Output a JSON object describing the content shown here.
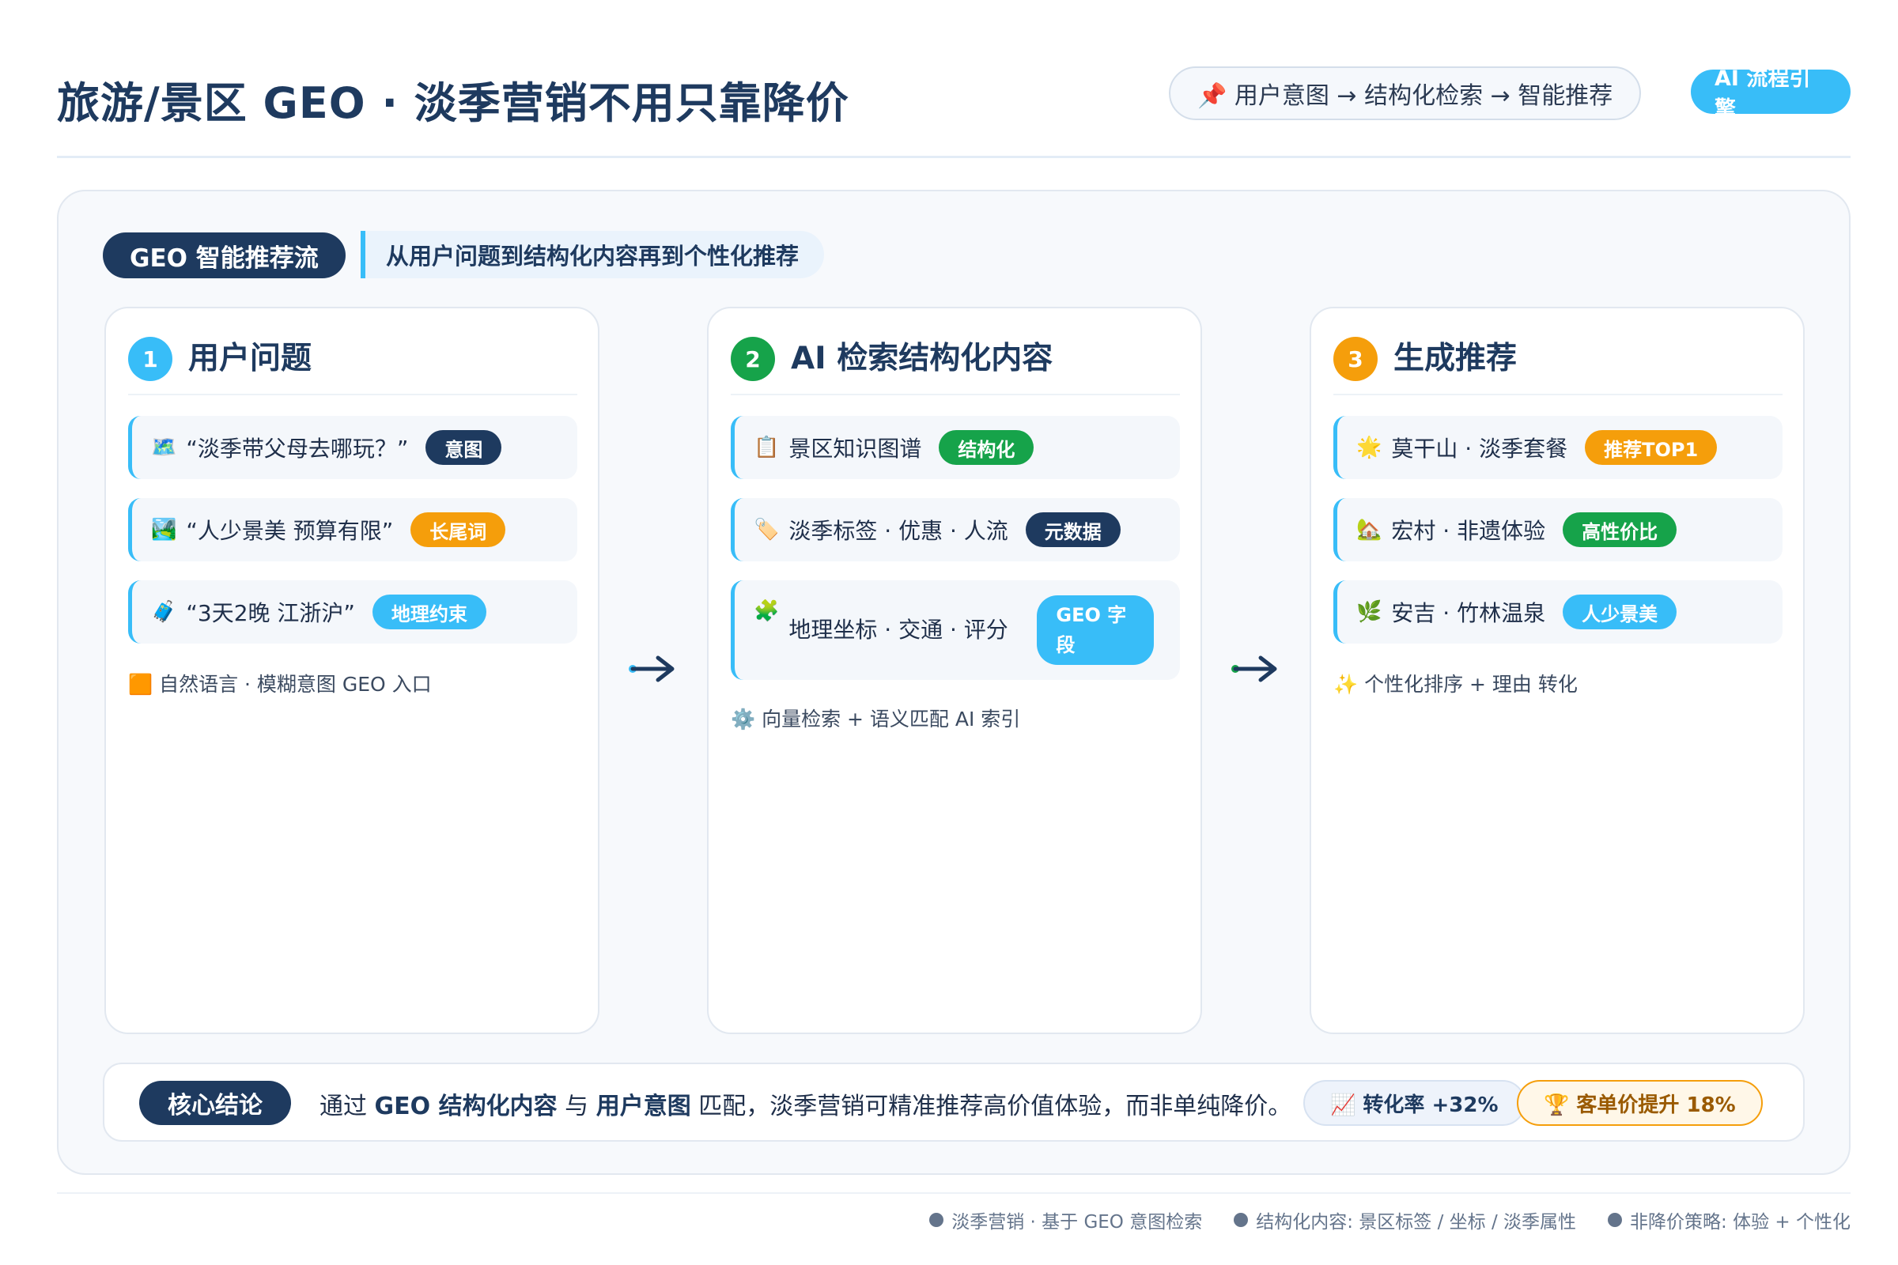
{
  "header": {
    "title": "旅游/景区 GEO · 淡季营销不用只靠降价",
    "flow_pill": "📌 用户意图 → 结构化检索 → 智能推荐",
    "engine_pill": "AI 流程引擎"
  },
  "section": {
    "label": "GEO 智能推荐流",
    "subtitle": "从用户问题到结构化内容再到个性化推荐"
  },
  "steps": [
    {
      "number": "1",
      "title": "用户问题",
      "items": [
        {
          "icon": "🗺️",
          "text": "“淡季带父母去哪玩？”",
          "tag": "意图"
        },
        {
          "icon": "🏞️",
          "text": "“人少景美 预算有限”",
          "tag": "长尾词"
        },
        {
          "icon": "🧳",
          "text": "“3天2晚 江浙沪”",
          "tag": "地理约束"
        }
      ],
      "note_icon": "🟧",
      "note": "自然语言 · 模糊意图  GEO 入口"
    },
    {
      "number": "2",
      "title": "AI 检索结构化内容",
      "items": [
        {
          "icon": "📋",
          "text": "景区知识图谱",
          "tag": "结构化"
        },
        {
          "icon": "🏷️",
          "text": "淡季标签 · 优惠 · 人流",
          "tag": "元数据"
        },
        {
          "icon": "🧩",
          "text": "地理坐标 · 交通 · 评分",
          "tag": "GEO 字段"
        }
      ],
      "note_icon": "⚙️",
      "note": "向量检索 + 语义匹配  AI 索引"
    },
    {
      "number": "3",
      "title": "生成推荐",
      "items": [
        {
          "icon": "🌟",
          "text": "莫干山 · 淡季套餐",
          "tag": "推荐TOP1"
        },
        {
          "icon": "🏡",
          "text": "宏村 · 非遗体验",
          "tag": "高性价比"
        },
        {
          "icon": "🌿",
          "text": "安吉 · 竹林温泉",
          "tag": "人少景美"
        }
      ],
      "note_icon": "✨",
      "note": "个性化排序 + 理由  转化"
    }
  ],
  "conclusion": {
    "label": "核心结论",
    "text_pre": "通过 ",
    "text_b1": "GEO 结构化内容",
    "text_mid": " 与 ",
    "text_b2": "用户意图",
    "text_post": " 匹配，淡季营销可精准推荐高价值体验，而非单纯降价。",
    "metric1": "📈 转化率 +32%",
    "metric2": "🏆 客单价提升 18%"
  },
  "footer": [
    "淡季营销 · 基于 GEO 意图检索",
    "结构化内容: 景区标签 / 坐标 / 淡季属性",
    "非降价策略: 体验 + 个性化"
  ],
  "colors": {
    "navy": "#1e3a5f",
    "sky": "#38bdf8",
    "orange": "#f59e0b",
    "green": "#16a34a"
  }
}
